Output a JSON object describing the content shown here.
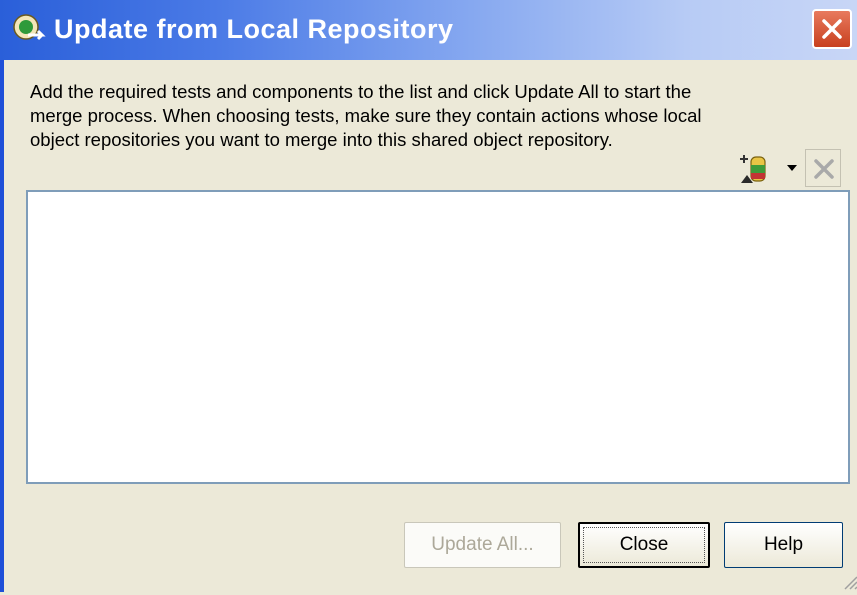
{
  "window": {
    "title": "Update from Local Repository",
    "description": "Add the required tests and components to the list and click Update All to start the merge process. When choosing tests, make sure they contain actions whose local object repositories you want to merge into this shared object repository."
  },
  "toolbar": {
    "add_icon": "add-test-icon",
    "delete_icon": "delete-icon"
  },
  "list": {
    "items": []
  },
  "buttons": {
    "update_all": "Update All...",
    "close": "Close",
    "help": "Help"
  },
  "colors": {
    "title_bar": "#2a5fd9",
    "close_button": "#d0502c",
    "window_bg": "#ece9d8"
  }
}
